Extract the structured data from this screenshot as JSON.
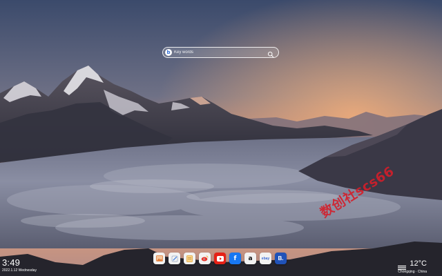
{
  "search": {
    "engine_letter": "b",
    "placeholder": "Key words",
    "icon": "search-icon"
  },
  "clock": {
    "time": "3:49",
    "date": "2022.1.12 Wednesday"
  },
  "weather": {
    "temperature": "12°C",
    "location": "Chongqing · China",
    "icon": "fog-icon"
  },
  "dock": {
    "apps": [
      {
        "name": "photos-app",
        "icon": "image-icon",
        "bg": "#f2f2f2",
        "fg": "#e07b39"
      },
      {
        "name": "pen-app",
        "icon": "pen-icon",
        "bg": "#f2f2f2",
        "fg": "#3a7be0"
      },
      {
        "name": "notes-app",
        "icon": "note-icon",
        "bg": "#f2f2f2",
        "fg": "#e8a43a"
      },
      {
        "name": "weibo-app",
        "icon": "weibo-icon",
        "bg": "#f2f2f2",
        "fg": "#e6332a"
      },
      {
        "name": "youtube-app",
        "icon": "play-icon",
        "bg": "#e62117",
        "fg": "#ffffff"
      },
      {
        "name": "facebook-app",
        "label": "f",
        "icon": "facebook-icon",
        "bg": "#1877f2",
        "fg": "#ffffff"
      },
      {
        "name": "amazon-app",
        "label": "a",
        "icon": "amazon-icon",
        "bg": "#f2f2f2",
        "fg": "#111111"
      },
      {
        "name": "ebay-app",
        "label": "ebay",
        "icon": "ebay-icon",
        "bg": "#f2f2f2",
        "fg": "#3b6bd6"
      },
      {
        "name": "bing-app",
        "label": "B.",
        "icon": "b-icon",
        "bg": "#2052b8",
        "fg": "#ffffff"
      }
    ]
  },
  "watermark": {
    "text": "数创社scs66"
  },
  "colors": {
    "watermark": "#d41e2a",
    "sky_top": "#3b4a6b",
    "sky_glow": "#f1a06a"
  }
}
